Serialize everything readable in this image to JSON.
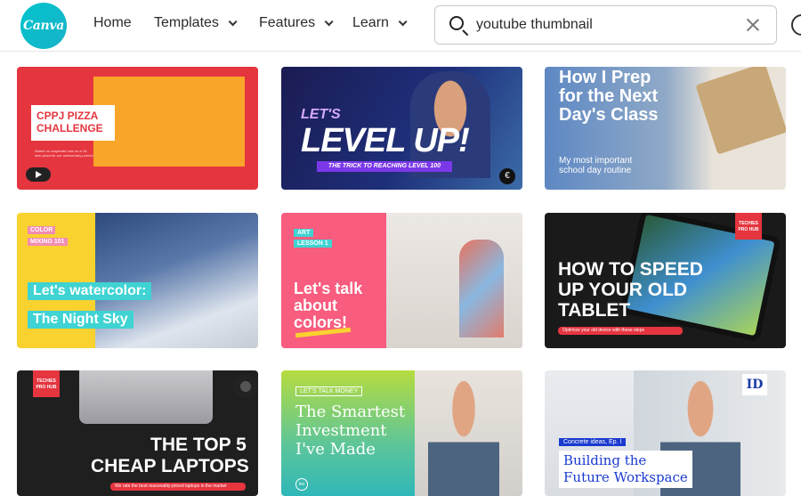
{
  "header": {
    "logo_text": "Canva",
    "nav": {
      "home": "Home",
      "templates": "Templates",
      "features": "Features",
      "learn": "Learn"
    },
    "search": {
      "value": "youtube thumbnail",
      "placeholder": ""
    }
  },
  "thumbnails": [
    {
      "title_line1": "CPPJ PIZZA",
      "title_line2": "CHALLENGE",
      "sub": "Watch us cooperate now on a 15-inch pizza for our anniversary promo!"
    },
    {
      "kicker": "LET'S",
      "title": "LEVEL UP!",
      "sub": "THE TRICK TO REACHING LEVEL 100",
      "badge": "€"
    },
    {
      "title_line1": "How I Prep",
      "title_line2": "for the Next",
      "title_line3": "Day's Class",
      "sub_line1": "My most important",
      "sub_line2": "school day routine"
    },
    {
      "tag1": "COLOR",
      "tag2": "MIXING 101",
      "title_line1": "Let's watercolor:",
      "title_line2": "The Night Sky"
    },
    {
      "tag1": "ART",
      "tag2": "LESSON 1",
      "title_line1": "Let's talk",
      "title_line2": "about",
      "title_line3": "colors!"
    },
    {
      "logo": "TECHIES PRO HUB",
      "title_line1": "HOW TO SPEED",
      "title_line2": "UP YOUR OLD",
      "title_line3": "TABLET",
      "sub": "Optimize your old device with these steps"
    },
    {
      "logo": "TECHIES PRO HUB",
      "title_line1": "THE TOP 5",
      "title_line2": "CHEAP LAPTOPS",
      "sub": "We rate the best reasonably-priced laptops in the market"
    },
    {
      "tag": "LET'S TALK MONEY",
      "title_line1": "The Smartest",
      "title_line2": "Investment",
      "title_line3": "I've Made",
      "badge": "ino"
    },
    {
      "badge": "ID",
      "tag": "Concrete ideas, Ep. I",
      "title_line1": "Building the",
      "title_line2": "Future Workspace"
    }
  ]
}
